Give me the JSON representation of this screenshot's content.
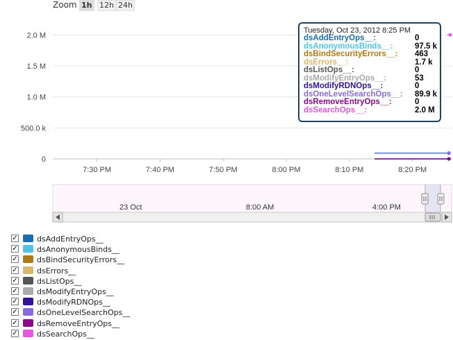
{
  "zoom": {
    "label": "Zoom",
    "options": [
      "1h",
      "12h",
      "24h"
    ],
    "active": "1h"
  },
  "tooltip": {
    "header": "Tuesday, Oct 23, 2012 8:25 PM",
    "rows": [
      {
        "name": "dsAddEntryOps__:",
        "value": "0",
        "color": "#1a6fb0"
      },
      {
        "name": "dsAnonymousBinds__:",
        "value": "97.5 k",
        "color": "#4ec3e8"
      },
      {
        "name": "dsBindSecurityErrors__:",
        "value": "463",
        "color": "#b07a10"
      },
      {
        "name": "dsErrors__:",
        "value": "1.7 k",
        "color": "#d8b86a"
      },
      {
        "name": "dsListOps__:",
        "value": "0",
        "color": "#555555"
      },
      {
        "name": "dsModifyEntryOps__:",
        "value": "53",
        "color": "#aaaaaa"
      },
      {
        "name": "dsModifyRDNOps__:",
        "value": "0",
        "color": "#33109a"
      },
      {
        "name": "dsOneLevelSearchOps__:",
        "value": "89.9 k",
        "color": "#8a6ae0"
      },
      {
        "name": "dsRemoveEntryOps__:",
        "value": "0",
        "color": "#8a0a8a"
      },
      {
        "name": "dsSearchOps__:",
        "value": "2.0 M",
        "color": "#e855e0"
      }
    ]
  },
  "navigator": {
    "labels": [
      "23 Oct",
      "8:00 AM",
      "4:00 PM"
    ]
  },
  "chart_data": {
    "type": "line",
    "y_tick_labels": [
      "0",
      "500.0 k",
      "1.0 M",
      "1.5 M",
      "2.0 M"
    ],
    "y_ticks": [
      0,
      500000,
      1000000,
      1500000,
      2000000
    ],
    "ylim": [
      0,
      2350000
    ],
    "x_tick_labels": [
      "7:30 PM",
      "7:40 PM",
      "7:50 PM",
      "8:00 PM",
      "8:10 PM",
      "8:20 PM"
    ],
    "x_ticks_min": [
      0,
      10,
      20,
      30,
      40,
      50
    ],
    "xlim_min": [
      -7,
      56.2
    ],
    "grid": true,
    "legend_position": "bottom-left",
    "series": [
      {
        "name": "dsAddEntryOps__",
        "color": "#1a6fb0",
        "x": [
          44,
          56
        ],
        "y": [
          0,
          0
        ]
      },
      {
        "name": "dsAnonymousBinds__",
        "color": "#4ec3e8",
        "x": [
          44,
          55,
          56
        ],
        "y": [
          97500,
          97500,
          97500
        ]
      },
      {
        "name": "dsBindSecurityErrors__",
        "color": "#b07a10",
        "x": [
          44,
          56
        ],
        "y": [
          463,
          463
        ]
      },
      {
        "name": "dsErrors__",
        "color": "#d8b86a",
        "x": [
          44,
          56
        ],
        "y": [
          1700,
          1700
        ]
      },
      {
        "name": "dsListOps__",
        "color": "#555555",
        "x": [
          44,
          56
        ],
        "y": [
          0,
          0
        ]
      },
      {
        "name": "dsModifyEntryOps__",
        "color": "#aaaaaa",
        "x": [
          44,
          56
        ],
        "y": [
          53,
          53
        ]
      },
      {
        "name": "dsModifyRDNOps__",
        "color": "#33109a",
        "x": [
          44,
          56
        ],
        "y": [
          0,
          0
        ]
      },
      {
        "name": "dsOneLevelSearchOps__",
        "color": "#8a6ae0",
        "x": [
          44,
          55,
          56
        ],
        "y": [
          89900,
          89900,
          89900
        ]
      },
      {
        "name": "dsRemoveEntryOps__",
        "color": "#8a0a8a",
        "x": [
          44,
          56
        ],
        "y": [
          0,
          0
        ]
      },
      {
        "name": "dsSearchOps__",
        "color": "#e855e0",
        "x": [
          55.5,
          56.2
        ],
        "y": [
          2000000,
          2000000
        ]
      }
    ]
  },
  "legend": {
    "items": [
      {
        "label": "dsAddEntryOps__",
        "color": "#1a6fb0",
        "checked": true
      },
      {
        "label": "dsAnonymousBinds__",
        "color": "#4ec3e8",
        "checked": true
      },
      {
        "label": "dsBindSecurityErrors__",
        "color": "#b07a10",
        "checked": true
      },
      {
        "label": "dsErrors__",
        "color": "#d8b86a",
        "checked": true
      },
      {
        "label": "dsListOps__",
        "color": "#555555",
        "checked": true
      },
      {
        "label": "dsModifyEntryOps__",
        "color": "#aaaaaa",
        "checked": true
      },
      {
        "label": "dsModifyRDNOps__",
        "color": "#33109a",
        "checked": true
      },
      {
        "label": "dsOneLevelSearchOps__",
        "color": "#8a6ae0",
        "checked": true
      },
      {
        "label": "dsRemoveEntryOps__",
        "color": "#8a0a8a",
        "checked": true
      },
      {
        "label": "dsSearchOps__",
        "color": "#e855e0",
        "checked": true
      }
    ]
  }
}
